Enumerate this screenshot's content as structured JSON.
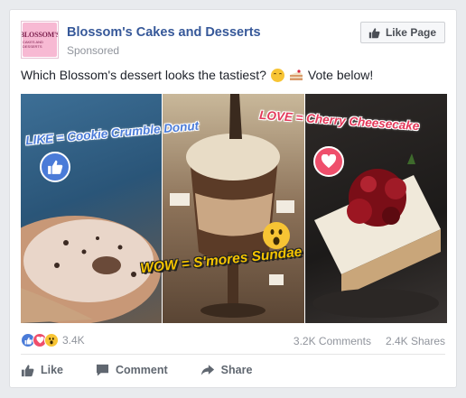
{
  "post": {
    "page_name": "Blossom's Cakes and Desserts",
    "sponsored_label": "Sponsored",
    "like_page_label": "Like Page",
    "logo_text": "BLOSSOM'S",
    "logo_subtext": "CAKES AND DESSERTS",
    "text": "Which Blossom's dessert looks the tastiest?",
    "text_suffix": "Vote below!"
  },
  "image": {
    "like_label": "LIKE = Cookie Crumble Donut",
    "love_label": "LOVE = Cherry Cheesecake",
    "wow_label": "WOW = S'mores Sundae",
    "colors": {
      "like": "#4a7bd8",
      "love": "#ef4f6c",
      "wow": "#f7c434"
    }
  },
  "summary": {
    "reaction_count": "3.4K",
    "comments": "3.2K Comments",
    "shares": "2.4K Shares",
    "reaction_icons": [
      "like-icon",
      "love-icon",
      "wow-icon"
    ]
  },
  "actions": {
    "like_label": "Like",
    "comment_label": "Comment",
    "share_label": "Share"
  }
}
